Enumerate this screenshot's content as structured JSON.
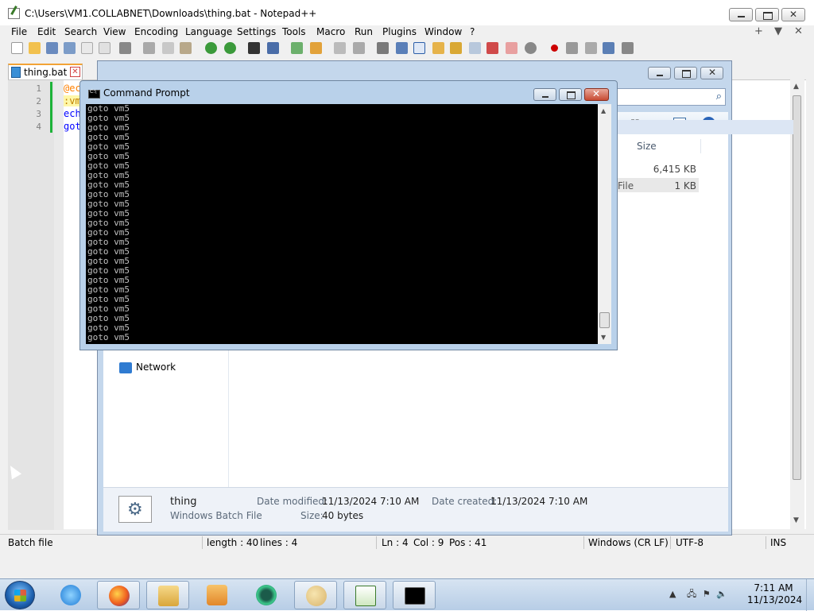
{
  "notepad": {
    "title": "C:\\Users\\VM1.COLLABNET\\Downloads\\thing.bat - Notepad++",
    "menu": [
      "File",
      "Edit",
      "Search",
      "View",
      "Encoding",
      "Language",
      "Settings",
      "Tools",
      "Macro",
      "Run",
      "Plugins",
      "Window",
      "?"
    ],
    "tab_controls": [
      "+",
      "▼",
      "✕"
    ],
    "tab": {
      "label": "thing.bat",
      "close": "✕"
    },
    "line_numbers": [
      "1",
      "2",
      "3",
      "4"
    ],
    "code_lines": [
      "@ech",
      ":vm5",
      "echo",
      "goto"
    ],
    "status": {
      "file_type": "Batch file",
      "length": "length : 40",
      "lines": "lines : 4",
      "ln": "Ln : 4",
      "col": "Col : 9",
      "pos": "Pos : 41",
      "eol": "Windows (CR LF)",
      "encoding": "UTF-8",
      "mode": "INS"
    }
  },
  "explorer": {
    "column_size": "Size",
    "size_row1": "6,415 KB",
    "type_row2": "File",
    "size_row2": "1 KB",
    "nav_network": "Network",
    "details": {
      "name": "thing",
      "type": "Windows Batch File",
      "date_modified_label": "Date modified:",
      "date_modified": "11/13/2024 7:10 AM",
      "date_created_label": "Date created:",
      "date_created": "11/13/2024 7:10 AM",
      "size_label": "Size:",
      "size": "40 bytes"
    }
  },
  "cmd": {
    "title": "Command Prompt",
    "output_lines": [
      "goto vm5",
      "goto vm5",
      "goto vm5",
      "goto vm5",
      "goto vm5",
      "goto vm5",
      "goto vm5",
      "goto vm5",
      "goto vm5",
      "goto vm5",
      "goto vm5",
      "goto vm5",
      "goto vm5",
      "goto vm5",
      "goto vm5",
      "goto vm5",
      "goto vm5",
      "goto vm5",
      "goto vm5",
      "goto vm5",
      "goto vm5",
      "goto vm5",
      "goto vm5",
      "goto vm5",
      "goto vm5"
    ]
  },
  "taskbar": {
    "apps": [
      "start-button",
      "internet-explorer",
      "firefox",
      "file-explorer",
      "media-player",
      "app-green-circle",
      "paint",
      "notepad-plus-plus",
      "command-prompt"
    ],
    "time": "7:11 AM",
    "date": "11/13/2024"
  }
}
